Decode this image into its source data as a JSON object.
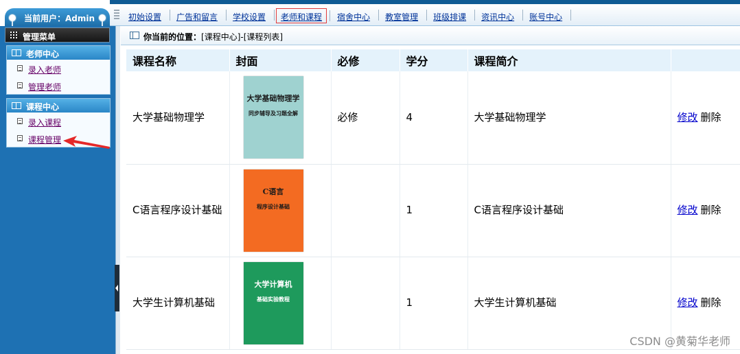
{
  "header": {
    "user_label": "当前用户：Admin",
    "nav": [
      {
        "label": "初始设置",
        "active": false
      },
      {
        "label": "广告和留言",
        "active": false
      },
      {
        "label": "学校设置",
        "active": false
      },
      {
        "label": "老师和课程",
        "active": true
      },
      {
        "label": "宿舍中心",
        "active": false
      },
      {
        "label": "教室管理",
        "active": false
      },
      {
        "label": "班级排课",
        "active": false
      },
      {
        "label": "资讯中心",
        "active": false
      },
      {
        "label": "账号中心",
        "active": false
      }
    ]
  },
  "sidebar": {
    "title": "管理菜单",
    "groups": [
      {
        "title": "老师中心",
        "items": [
          "录入老师",
          "管理老师"
        ]
      },
      {
        "title": "课程中心",
        "items": [
          "录入课程",
          "课程管理"
        ]
      }
    ]
  },
  "breadcrumb": {
    "prefix": "你当前的位置：",
    "path": "[课程中心]-[课程列表]"
  },
  "table": {
    "headers": [
      "课程名称",
      "封面",
      "必修",
      "学分",
      "课程简介",
      ""
    ],
    "rows": [
      {
        "name": "大学基础物理学",
        "required": "必修",
        "credit": "4",
        "intro": "大学基础物理学",
        "edit": "修改",
        "delete": "删除",
        "cover": {
          "title": "大学基础物理学",
          "line2": "同步辅导及习题全解",
          "bg": "#9fd2d0",
          "fg": "#1b1b1b"
        }
      },
      {
        "name": "C语言程序设计基础",
        "required": "",
        "credit": "1",
        "intro": "C语言程序设计基础",
        "edit": "修改",
        "delete": "删除",
        "cover": {
          "title": "C语言",
          "line2": "程序设计基础",
          "bg": "#f36b22",
          "fg": "#1b1b1b"
        }
      },
      {
        "name": "大学生计算机基础",
        "required": "",
        "credit": "1",
        "intro": "大学生计算机基础",
        "edit": "修改",
        "delete": "删除",
        "cover": {
          "title": "大学计算机",
          "line2": "基础实验教程",
          "bg": "#1e9a5c",
          "fg": "#ffffff"
        }
      }
    ]
  },
  "watermark": "CSDN @黄菊华老师",
  "colors": {
    "sidebar": "#1e71b3",
    "table_header": "#e4f2fb",
    "active_border": "#e23a3a",
    "link": "#0000cc"
  }
}
